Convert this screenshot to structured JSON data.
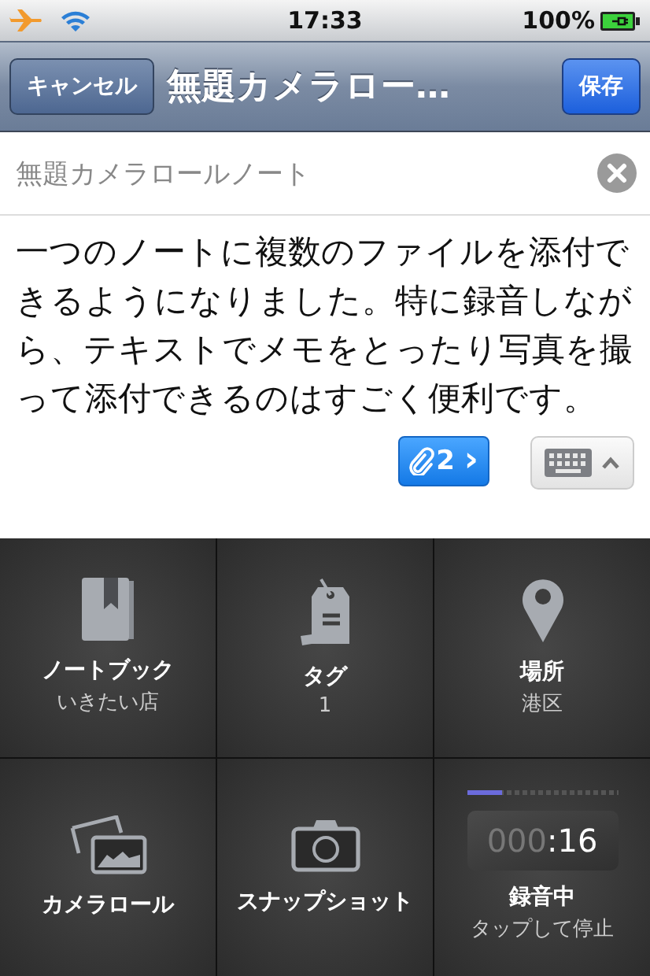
{
  "status_bar": {
    "time": "17:33",
    "battery": "100%"
  },
  "nav_bar": {
    "cancel": "キャンセル",
    "title": "無題カメラロー…",
    "save": "保存"
  },
  "note_title": {
    "value": "無題カメラロールノート"
  },
  "note_body": "一つのノートに複数のファイルを添付できるようになりました。特に録音しながら、テキストでメモをとったり写真を撮って添付できるのはすごく便利です。",
  "attachments": {
    "count": "2",
    "chevron": "›"
  },
  "actions": [
    {
      "kind": "notebook",
      "label": "ノートブック",
      "sub": "いきたい店"
    },
    {
      "kind": "tag",
      "label": "タグ",
      "sub": "1"
    },
    {
      "kind": "place",
      "label": "場所",
      "sub": "港区"
    },
    {
      "kind": "camera_roll",
      "label": "カメラロール"
    },
    {
      "kind": "snapshot",
      "label": "スナップショット"
    },
    {
      "kind": "recording",
      "label": "録音中",
      "sub": "タップして停止",
      "level": 0.23,
      "timer_dim": "000",
      "timer_lit": ":16"
    }
  ]
}
